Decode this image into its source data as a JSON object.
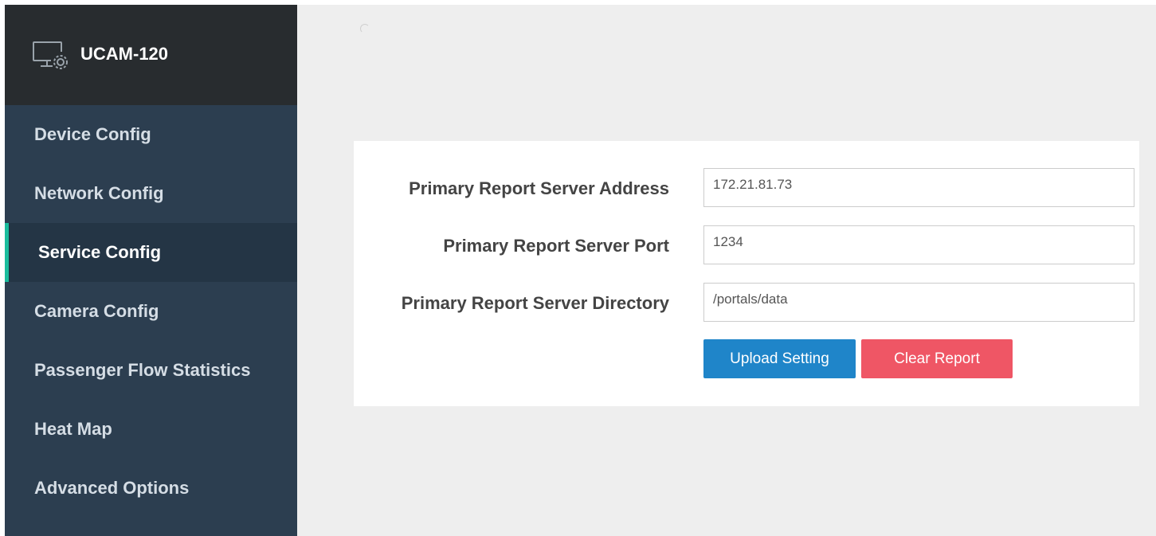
{
  "app": {
    "title": "UCAM-120",
    "brand_icon": "monitor-gear-icon"
  },
  "sidebar": {
    "items": [
      {
        "label": "Device Config"
      },
      {
        "label": "Network Config"
      },
      {
        "label": "Service Config",
        "active": true
      },
      {
        "label": "Camera Config"
      },
      {
        "label": "Passenger Flow Statistics"
      },
      {
        "label": "Heat Map"
      },
      {
        "label": "Advanced Options"
      }
    ]
  },
  "form": {
    "address_label": "Primary Report Server Address",
    "address_value": "172.21.81.73",
    "port_label": "Primary Report Server Port",
    "port_value": "1234",
    "directory_label": "Primary Report Server Directory",
    "directory_value": "/portals/data",
    "upload_button": "Upload Setting",
    "clear_button": "Clear Report"
  },
  "colors": {
    "sidebar_bg": "#2c3e50",
    "brand_bg": "#282c2f",
    "active_indicator": "#1abc9c",
    "upload_button": "#1f85c9",
    "clear_button": "#ef5665"
  }
}
